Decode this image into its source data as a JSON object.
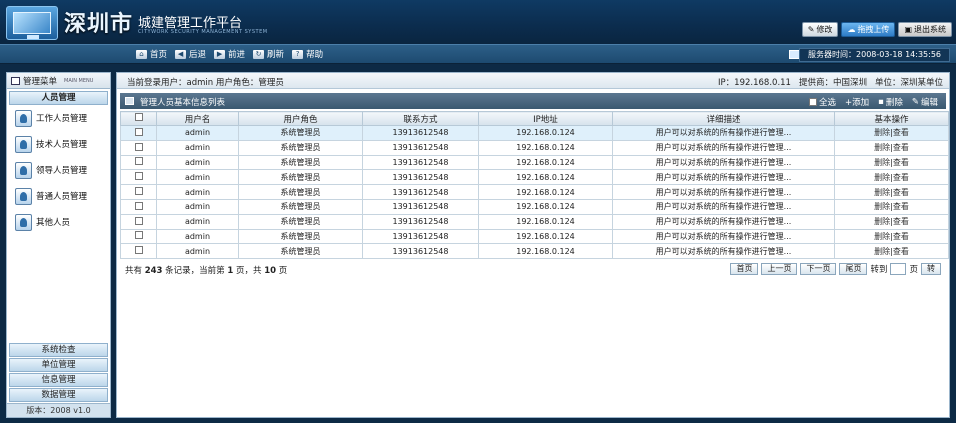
{
  "header": {
    "city": "深圳市",
    "title": "城建管理工作平台",
    "subtitle": "CITYWORK SECURITY MANAGEMENT SYSTEM",
    "buttons": {
      "modify": "修改",
      "drag_upload": "拖拽上传",
      "logout": "退出系统"
    }
  },
  "nav": {
    "items": [
      {
        "label": "首页",
        "icon": "home-icon"
      },
      {
        "label": "后退",
        "icon": "back-icon"
      },
      {
        "label": "前进",
        "icon": "forward-icon"
      },
      {
        "label": "刷新",
        "icon": "refresh-icon"
      },
      {
        "label": "帮助",
        "icon": "help-icon"
      }
    ],
    "server_time": "服务器时间：2008-03-18 14:35:56"
  },
  "sidebar": {
    "title": "管理菜单",
    "title_en": "MAIN MENU",
    "group": "人员管理",
    "items": [
      {
        "label": "工作人员管理",
        "icon": "worker-icon"
      },
      {
        "label": "技术人员管理",
        "icon": "tech-icon"
      },
      {
        "label": "领导人员管理",
        "icon": "leader-icon"
      },
      {
        "label": "普通人员管理",
        "icon": "lock-user-icon"
      },
      {
        "label": "其他人员",
        "icon": "other-user-icon"
      }
    ],
    "footer_groups": [
      "系统检查",
      "单位管理",
      "信息管理",
      "数据管理"
    ],
    "version": "版本：2008 v1.0"
  },
  "infobar": {
    "login": "当前登录用户：admin  用户角色：管理员",
    "ip": "IP：192.168.0.11",
    "provider": "提供商：中国深圳",
    "unit": "单位：深圳某单位"
  },
  "panel": {
    "title": "管理人员基本信息列表",
    "actions": {
      "select_all": "全选",
      "add": "+添加",
      "delete": "删除",
      "edit": "编辑"
    }
  },
  "table": {
    "columns": [
      "用户名",
      "用户角色",
      "联系方式",
      "IP地址",
      "详细描述",
      "基本操作"
    ],
    "rows": [
      [
        "admin",
        "系统管理员",
        "13913612548",
        "192.168.0.124",
        "用户可以对系统的所有操作进行管理..."
      ],
      [
        "admin",
        "系统管理员",
        "13913612548",
        "192.168.0.124",
        "用户可以对系统的所有操作进行管理..."
      ],
      [
        "admin",
        "系统管理员",
        "13913612548",
        "192.168.0.124",
        "用户可以对系统的所有操作进行管理..."
      ],
      [
        "admin",
        "系统管理员",
        "13913612548",
        "192.168.0.124",
        "用户可以对系统的所有操作进行管理..."
      ],
      [
        "admin",
        "系统管理员",
        "13913612548",
        "192.168.0.124",
        "用户可以对系统的所有操作进行管理..."
      ],
      [
        "admin",
        "系统管理员",
        "13913612548",
        "192.168.0.124",
        "用户可以对系统的所有操作进行管理..."
      ],
      [
        "admin",
        "系统管理员",
        "13913612548",
        "192.168.0.124",
        "用户可以对系统的所有操作进行管理..."
      ],
      [
        "admin",
        "系统管理员",
        "13913612548",
        "192.168.0.124",
        "用户可以对系统的所有操作进行管理..."
      ],
      [
        "admin",
        "系统管理员",
        "13913612548",
        "192.168.0.124",
        "用户可以对系统的所有操作进行管理..."
      ]
    ],
    "ops": {
      "delete": "删除",
      "view": "查看"
    }
  },
  "pager": {
    "prefix": "共有 ",
    "total": "243",
    "mid": " 条记录，当前第 ",
    "current": "1",
    "mid2": " 页，共 ",
    "pages": "10",
    "suffix": " 页",
    "first": "首页",
    "prev": "上一页",
    "next": "下一页",
    "last": "尾页",
    "goto_label": "转到",
    "page_unit": "页",
    "go": "转"
  }
}
